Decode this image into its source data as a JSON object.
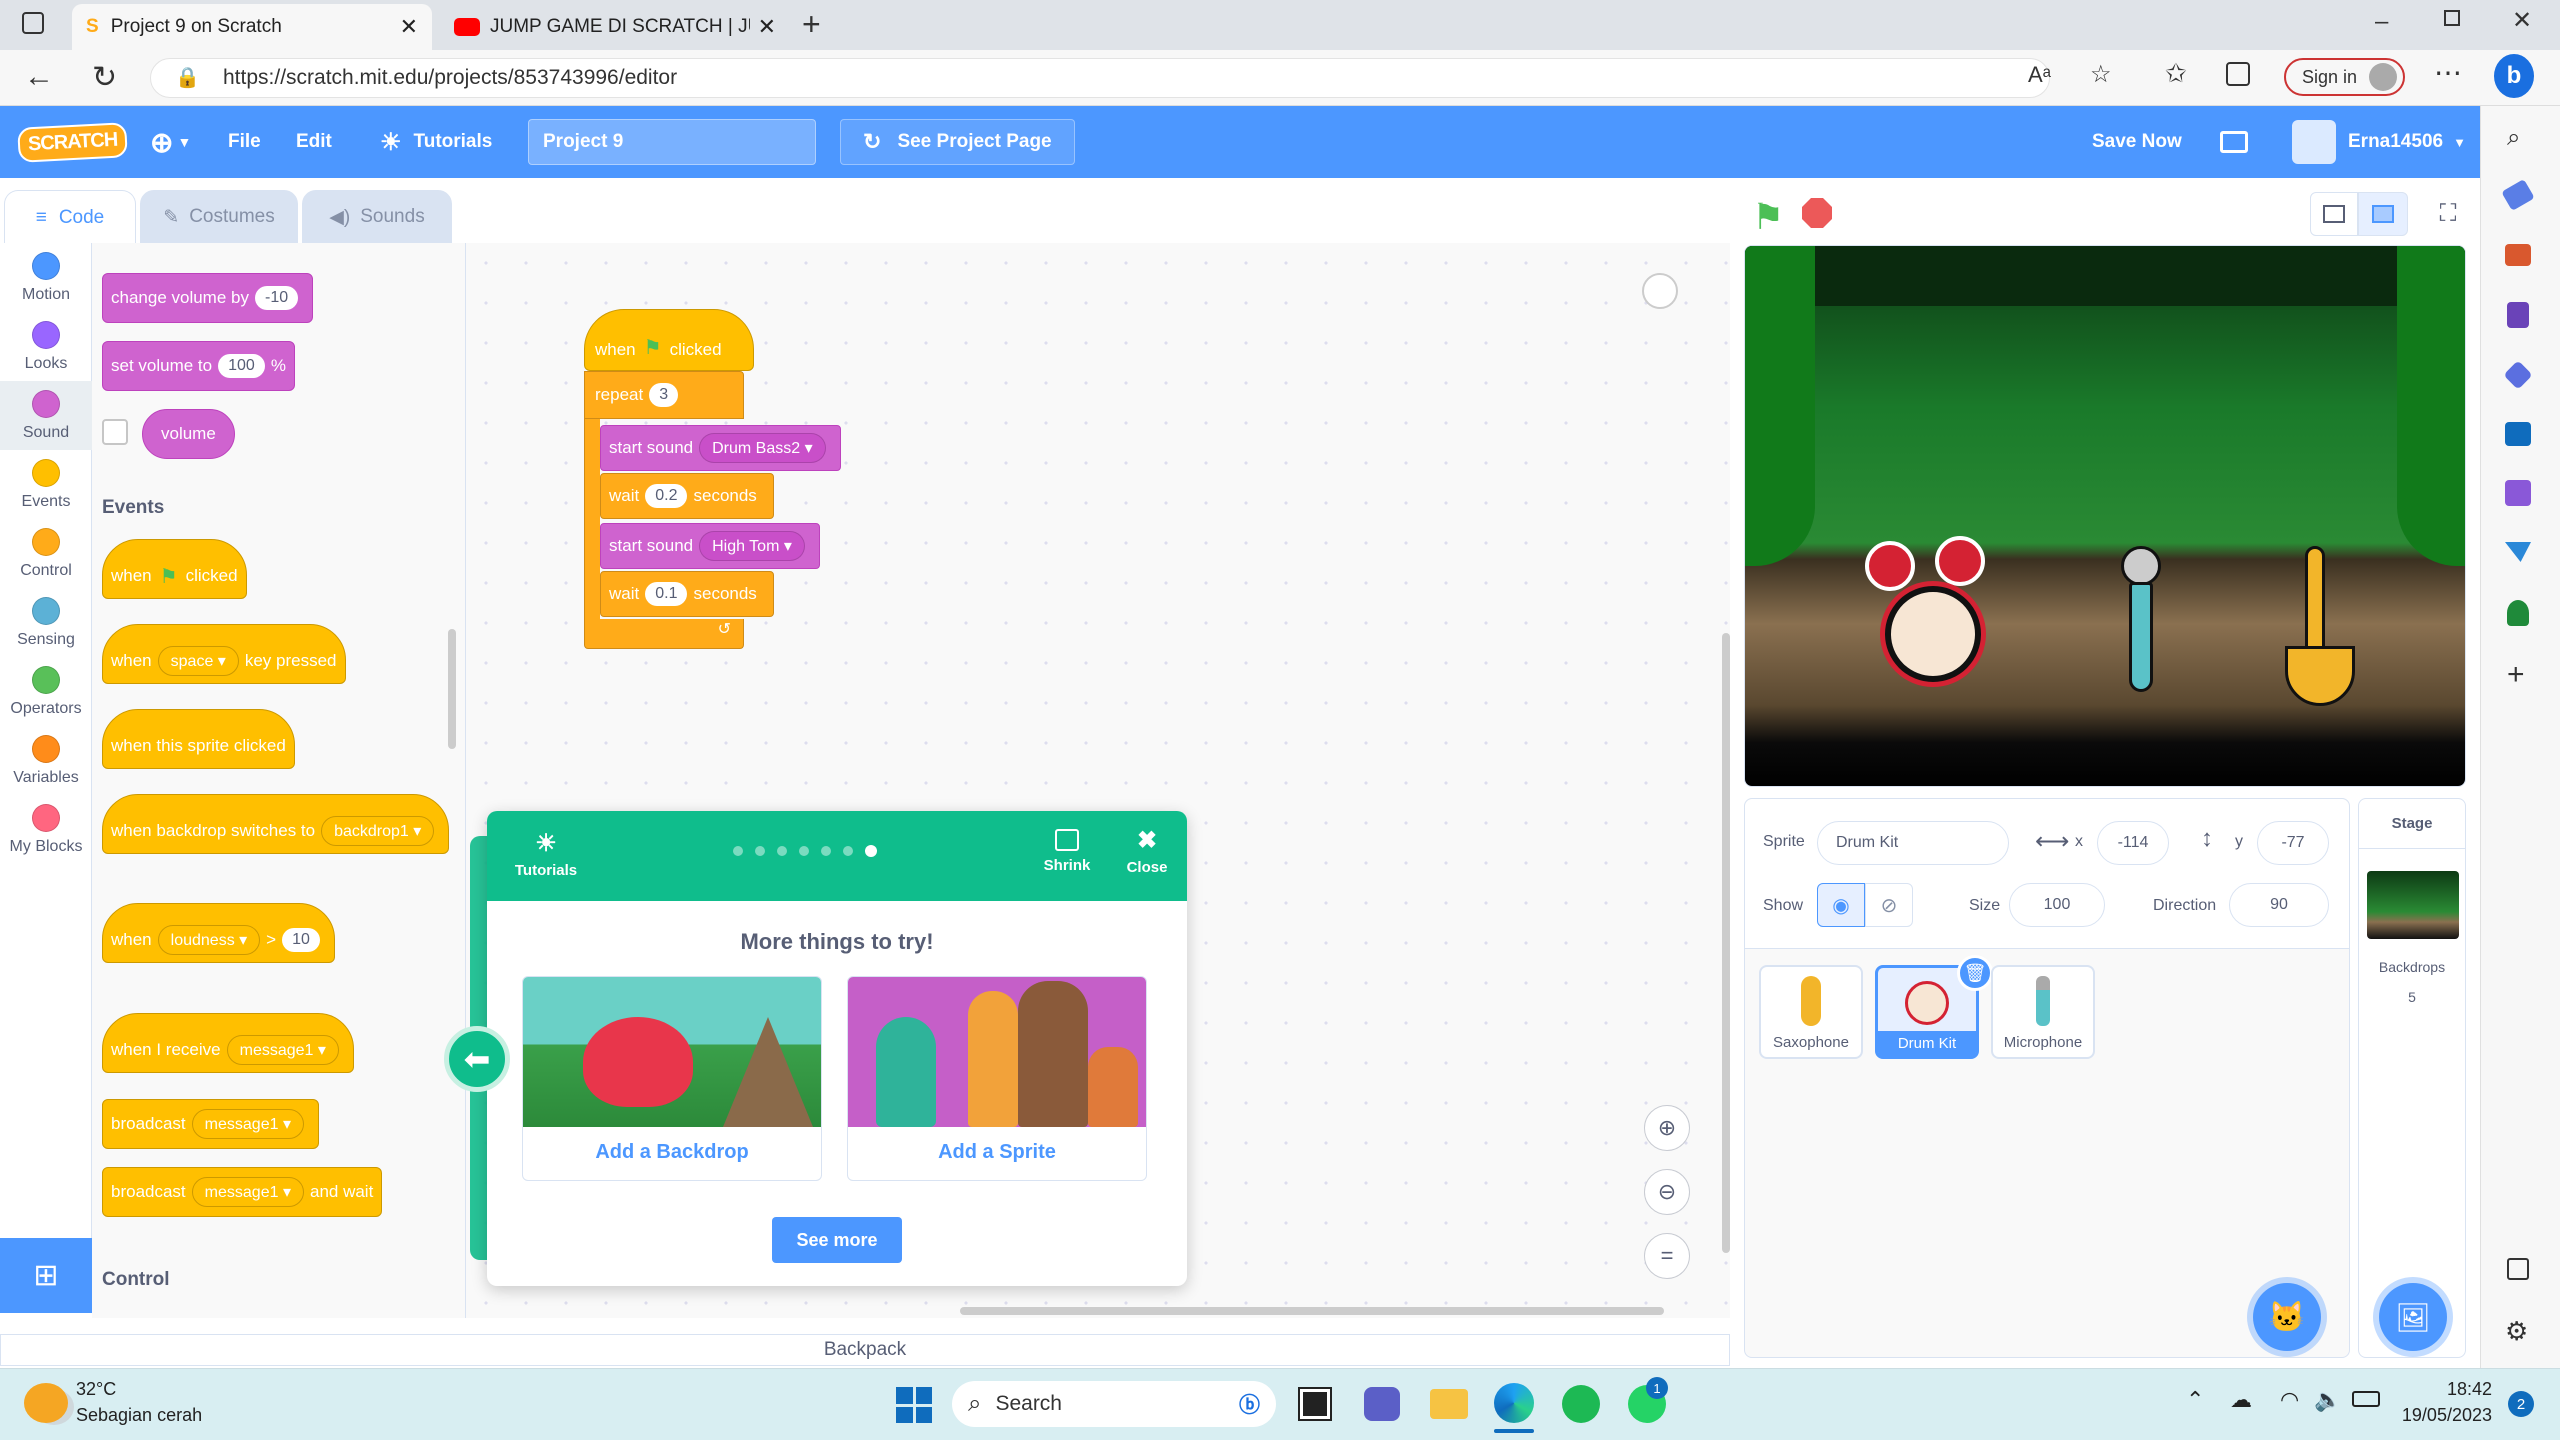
{
  "browser": {
    "tabs": [
      {
        "title": "Project 9 on Scratch"
      },
      {
        "title": "JUMP GAME DI SCRATCH | JUMP"
      }
    ],
    "url": "https://scratch.mit.edu/projects/853743996/editor",
    "signin_label": "Sign in"
  },
  "menu": {
    "logo": "SCRATCH",
    "file": "File",
    "edit": "Edit",
    "tutorials": "Tutorials",
    "project_title": "Project 9",
    "see_project": "See Project Page",
    "save_now": "Save Now",
    "username": "Erna14506"
  },
  "editor_tabs": {
    "code": "Code",
    "costumes": "Costumes",
    "sounds": "Sounds"
  },
  "categories": [
    {
      "label": "Motion",
      "color": "#4c97ff"
    },
    {
      "label": "Looks",
      "color": "#9966ff"
    },
    {
      "label": "Sound",
      "color": "#cf63cf"
    },
    {
      "label": "Events",
      "color": "#ffbf00"
    },
    {
      "label": "Control",
      "color": "#ffab19"
    },
    {
      "label": "Sensing",
      "color": "#5cb1d6"
    },
    {
      "label": "Operators",
      "color": "#59c059"
    },
    {
      "label": "Variables",
      "color": "#ff8c1a"
    },
    {
      "label": "My Blocks",
      "color": "#ff6680"
    }
  ],
  "palette": {
    "change_volume": {
      "text": "change volume by",
      "value": "-10"
    },
    "set_volume": {
      "text": "set volume to",
      "value": "100",
      "unit": "%"
    },
    "volume": "volume",
    "events_heading": "Events",
    "when": "when",
    "clicked": "clicked",
    "key_pressed": "key pressed",
    "key_value": "space",
    "sprite_clicked": "when this sprite clicked",
    "backdrop_switches": "when backdrop switches to",
    "backdrop_value": "backdrop1",
    "loudness": "loudness",
    "gt": ">",
    "loudness_value": "10",
    "when_receive": "when I receive",
    "message": "message1",
    "broadcast": "broadcast",
    "and_wait": "and wait",
    "control_heading": "Control"
  },
  "script": {
    "when": "when",
    "clicked": "clicked",
    "repeat": "repeat",
    "repeat_count": "3",
    "start_sound": "start sound",
    "sound1": "Drum Bass2",
    "sound2": "High Tom",
    "wait": "wait",
    "seconds": "seconds",
    "wait1": "0.2",
    "wait2": "0.1"
  },
  "modal": {
    "tutorials": "Tutorials",
    "shrink": "Shrink",
    "close": "Close",
    "title": "More things to try!",
    "card1": "Add a Backdrop",
    "card2": "Add a Sprite",
    "see_more": "See more",
    "dots": 7,
    "active_dot": 7
  },
  "backpack": "Backpack",
  "sprite_info": {
    "sprite_label": "Sprite",
    "sprite_name": "Drum Kit",
    "x_label": "x",
    "x": "-114",
    "y_label": "y",
    "y": "-77",
    "show_label": "Show",
    "size_label": "Size",
    "size": "100",
    "direction_label": "Direction",
    "direction": "90"
  },
  "sprites": [
    {
      "name": "Saxophone"
    },
    {
      "name": "Drum Kit",
      "selected": true
    },
    {
      "name": "Microphone"
    }
  ],
  "stage_panel": {
    "title": "Stage",
    "backdrops_label": "Backdrops",
    "backdrops_count": "5"
  },
  "taskbar": {
    "temp": "32°C",
    "weather": "Sebagian cerah",
    "search": "Search",
    "time": "18:42",
    "date": "19/05/2023",
    "notif_count": "2",
    "whatsapp_badge": "1"
  }
}
